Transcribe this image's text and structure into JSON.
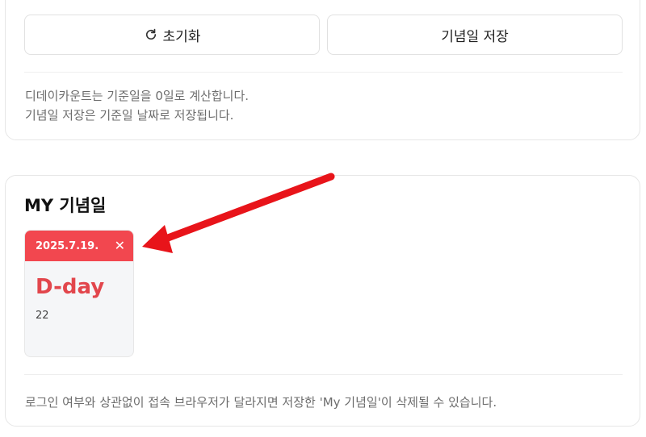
{
  "top_card": {
    "reset_label": "초기화",
    "save_label": "기념일 저장",
    "note_line1": "디데이카운트는 기준일을 0일로 계산합니다.",
    "note_line2": "기념일 저장은 기준일 날짜로 저장됩니다."
  },
  "my_card": {
    "title": "MY 기념일",
    "items": [
      {
        "date": "2025.7.19.",
        "close": "✕",
        "label": "D-day",
        "count": "22"
      }
    ],
    "note": "로그인 여부와 상관없이 접속 브라우저가 달라지면 저장한 'My 기념일'이 삭제될 수 있습니다."
  },
  "colors": {
    "accent": "#f2474f",
    "arrow": "#e8141a"
  },
  "icons": {
    "reset": "refresh-icon",
    "close": "close-icon",
    "annotation": "red-arrow-annotation"
  }
}
